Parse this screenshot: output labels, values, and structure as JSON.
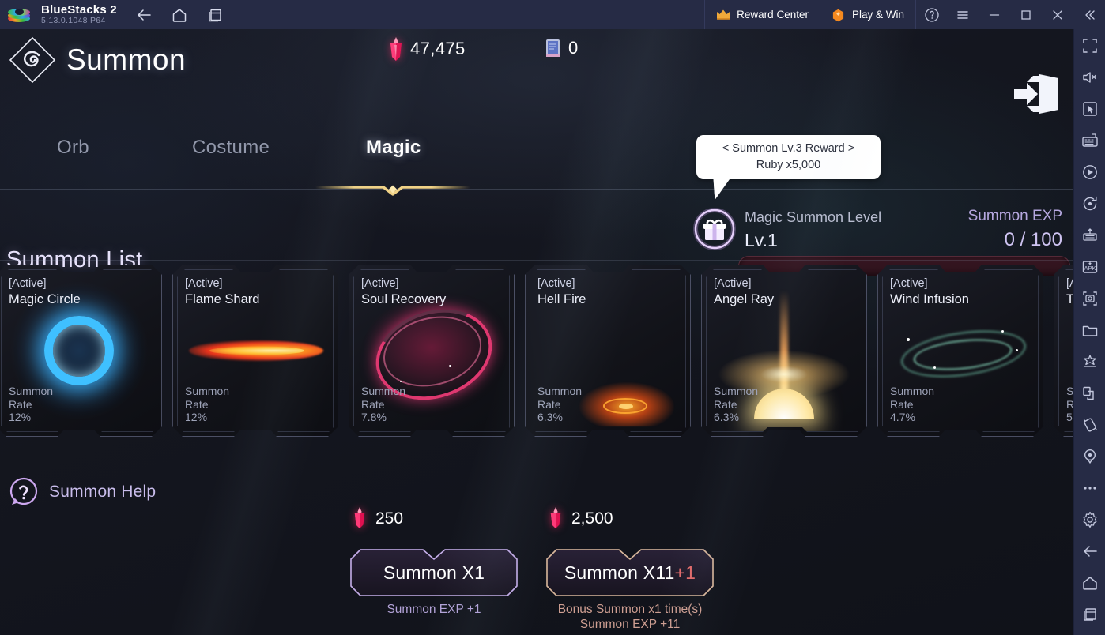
{
  "titlebar": {
    "app_name": "BlueStacks 2",
    "version": "5.13.0.1048  P64",
    "nav": [
      {
        "name": "back-icon",
        "label": "Back"
      },
      {
        "name": "home-icon",
        "label": "Home"
      },
      {
        "name": "multi-instance-icon",
        "label": "Instances"
      }
    ],
    "reward_center": "Reward Center",
    "play_and_win": "Play & Win",
    "controls": [
      {
        "name": "help-icon",
        "label": "Help"
      },
      {
        "name": "menu-icon",
        "label": "Menu"
      },
      {
        "name": "minimize-icon",
        "label": "Minimize"
      },
      {
        "name": "maximize-icon",
        "label": "Maximize"
      },
      {
        "name": "close-icon",
        "label": "Close"
      },
      {
        "name": "collapse-sidebar-icon",
        "label": "Collapse"
      }
    ]
  },
  "sidebar": {
    "items": [
      {
        "name": "fullscreen-icon",
        "label": "Full screen"
      },
      {
        "name": "mute-icon",
        "label": "Mute"
      },
      {
        "name": "cursor-icon",
        "label": "Game controls"
      },
      {
        "name": "keymapping-icon",
        "label": "Keymapping"
      },
      {
        "name": "macro-icon",
        "label": "Macro recorder"
      },
      {
        "name": "rotate-icon",
        "label": "Rotate"
      },
      {
        "name": "multi-instance-sync-icon",
        "label": "Instance sync"
      },
      {
        "name": "install-apk-icon",
        "label": "Install APK"
      },
      {
        "name": "screenshot-icon",
        "label": "Screenshot"
      },
      {
        "name": "media-manager-icon",
        "label": "Media manager"
      },
      {
        "name": "eco-mode-icon",
        "label": "Eco mode"
      },
      {
        "name": "copy-paste-icon",
        "label": "Copy paste"
      },
      {
        "name": "shake-icon",
        "label": "Shake"
      },
      {
        "name": "location-icon",
        "label": "Location"
      },
      {
        "name": "more-icon",
        "label": "More"
      },
      {
        "name": "settings-icon",
        "label": "Settings"
      },
      {
        "name": "back-icon",
        "label": "Back"
      },
      {
        "name": "home-icon",
        "label": "Home"
      },
      {
        "name": "recents-icon",
        "label": "Recents"
      }
    ]
  },
  "game": {
    "title": "Summon",
    "currencies": [
      {
        "name": "ruby",
        "value": "47,475"
      },
      {
        "name": "summon-scroll",
        "value": "0"
      }
    ],
    "exit_label": "Exit",
    "tabs": [
      {
        "label": "Orb",
        "active": false
      },
      {
        "label": "Costume",
        "active": false
      },
      {
        "label": "Magic",
        "active": true
      }
    ],
    "tooltip": {
      "line1": "< Summon Lv.3 Reward >",
      "line2": "Ruby x5,000"
    },
    "level_panel": {
      "level_label": "Magic Summon Level",
      "level_value": "Lv.1",
      "exp_label": "Summon EXP",
      "exp_value": "0 / 100",
      "exp_progress_percent": 0
    },
    "summon_list": {
      "heading": "Summon List",
      "rate_label_line1": "Summon",
      "rate_label_line2": "Rate",
      "cards": [
        {
          "tag": "[Active]",
          "name": "Magic Circle",
          "rate": "12%",
          "art": "ring-blue"
        },
        {
          "tag": "[Active]",
          "name": "Flame Shard",
          "rate": "12%",
          "art": "flame-orange"
        },
        {
          "tag": "[Active]",
          "name": "Soul Recovery",
          "rate": "7.8%",
          "art": "swirl-pink"
        },
        {
          "tag": "[Active]",
          "name": "Hell Fire",
          "rate": "6.3%",
          "art": "fire-rune"
        },
        {
          "tag": "[Active]",
          "name": "Angel Ray",
          "rate": "6.3%",
          "art": "light-burst"
        },
        {
          "tag": "[Active]",
          "name": "Wind Infusion",
          "rate": "4.7%",
          "art": "wind-green"
        },
        {
          "tag": "[A",
          "name": "T",
          "rate": "5",
          "art": "none"
        }
      ]
    },
    "help": {
      "label": "Summon Help",
      "icon": "question-icon"
    },
    "summon_buttons": [
      {
        "cost": "250",
        "label": "Summon X1",
        "label_bonus": "",
        "sub_line1": "Summon EXP +1",
        "sub_line2": "",
        "accent": "#c4aee8"
      },
      {
        "cost": "2,500",
        "label": "Summon X11",
        "label_bonus": "+1",
        "sub_line1": "Bonus Summon x1 time(s)",
        "sub_line2": "Summon EXP +11",
        "accent": "#d8b79a"
      }
    ]
  },
  "colors": {
    "titlebar_bg": "#262b45",
    "game_bg": "#14161f",
    "accent_gold": "#e7c66a",
    "accent_purple": "#c4aee8",
    "ruby_red": "#e81f5a"
  }
}
